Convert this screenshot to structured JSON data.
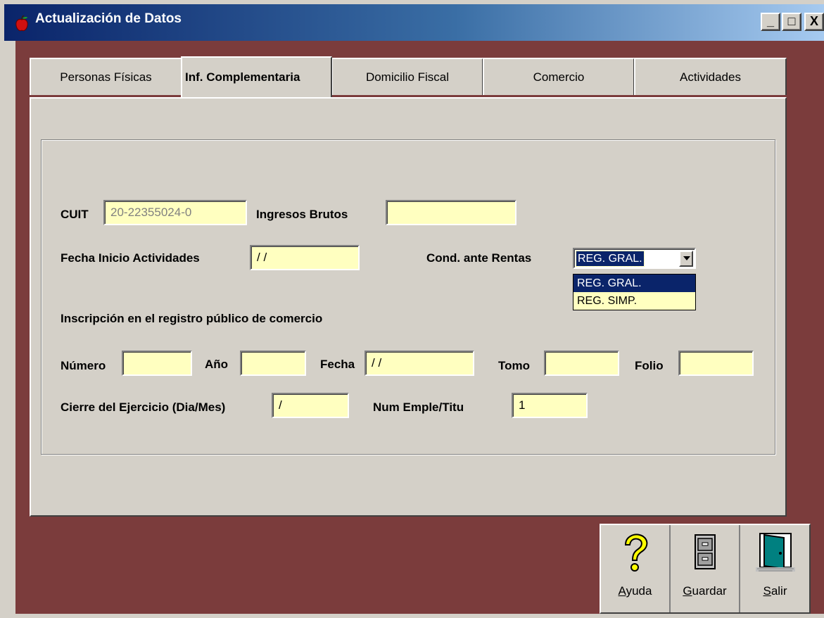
{
  "window": {
    "title": "Actualización de Datos",
    "controls": {
      "minimize": "_",
      "maximize": "□",
      "close": "X"
    }
  },
  "tabs": [
    {
      "label": "Personas Físicas",
      "active": false
    },
    {
      "label": "Inf. Complementaria",
      "active": true
    },
    {
      "label": "Domicilio Fiscal",
      "active": false
    },
    {
      "label": "Comercio",
      "active": false
    },
    {
      "label": "Actividades",
      "active": false
    }
  ],
  "form": {
    "cuit": {
      "label": "CUIT",
      "value": "20-22355024-0"
    },
    "ingresos_brutos": {
      "label": "Ingresos Brutos",
      "value": ""
    },
    "fecha_inicio": {
      "label": "Fecha Inicio Actividades",
      "value": " / /"
    },
    "cond_rentas": {
      "label": "Cond. ante Rentas",
      "selected": "REG. GRAL.",
      "options": [
        "REG. GRAL.",
        "REG. SIMP."
      ]
    },
    "registro_heading": "Inscripción en el registro público de comercio",
    "numero": {
      "label": "Número",
      "value": ""
    },
    "anio": {
      "label": "Año",
      "value": ""
    },
    "fecha": {
      "label": "Fecha",
      "value": " / /"
    },
    "tomo": {
      "label": "Tomo",
      "value": ""
    },
    "folio": {
      "label": "Folio",
      "value": ""
    },
    "cierre_ejercicio": {
      "label": "Cierre del Ejercicio (Dia/Mes)",
      "value": " /"
    },
    "num_emple": {
      "label": "Num Emple/Titu",
      "value": "1"
    }
  },
  "toolbar": {
    "ayuda": {
      "accel": "A",
      "rest": "yuda",
      "icon": "question-icon"
    },
    "guardar": {
      "accel": "G",
      "rest": "uardar",
      "icon": "cabinet-icon"
    },
    "salir": {
      "accel": "S",
      "rest": "alir",
      "icon": "door-icon"
    }
  },
  "colors": {
    "title_start": "#0a246a",
    "client_bg": "#7b3c3c",
    "field_bg": "#ffffc0",
    "selection": "#0a246a"
  }
}
